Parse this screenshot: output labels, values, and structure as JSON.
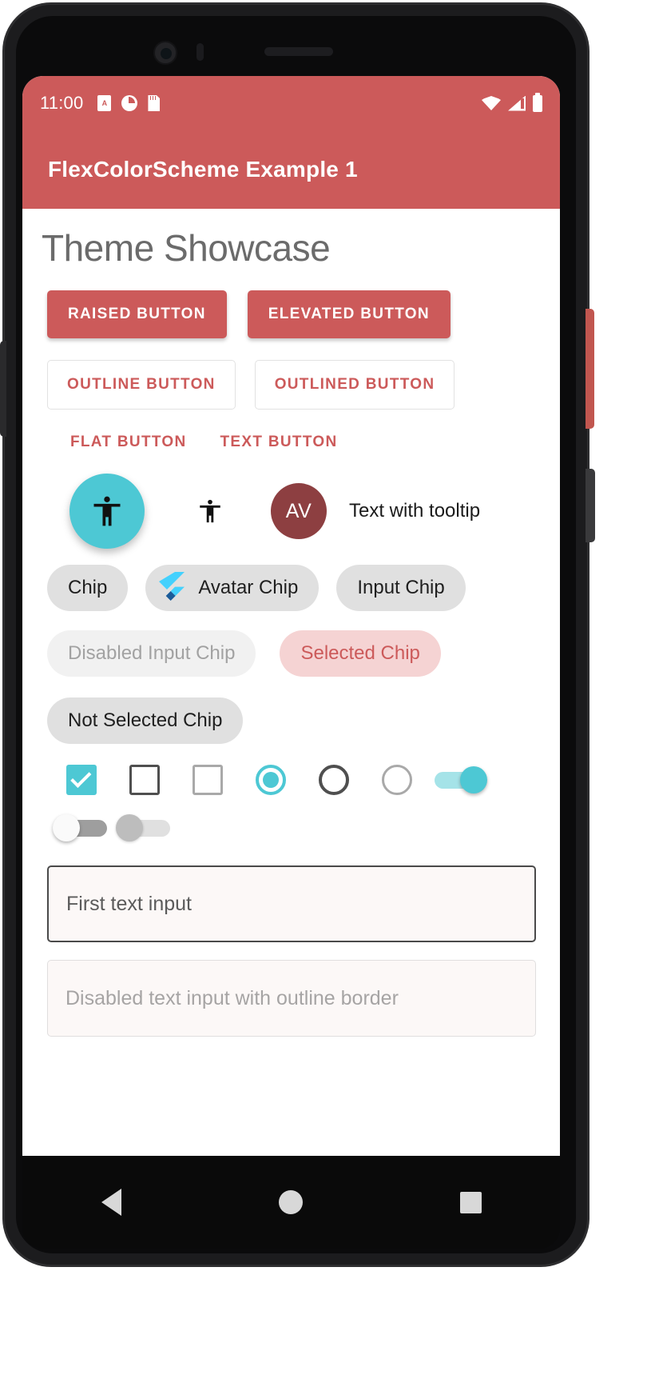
{
  "device": {
    "statusbar": {
      "time": "11:00",
      "left_icons": [
        "alarm-card-icon",
        "do-not-disturb-icon",
        "sdcard-icon"
      ],
      "right_icons": [
        "wifi-icon",
        "cellular-signal-icon",
        "battery-icon"
      ]
    },
    "navbar": {
      "back_label": "back-icon",
      "home_label": "home-icon",
      "recents_label": "recents-icon"
    }
  },
  "appbar": {
    "title": "FlexColorScheme Example 1"
  },
  "page": {
    "title": "Theme Showcase"
  },
  "buttons": {
    "raised": "RAISED BUTTON",
    "elevated": "ELEVATED BUTTON",
    "outline": "OUTLINE BUTTON",
    "outlined": "OUTLINED BUTTON",
    "flat": "FLAT BUTTON",
    "text": "TEXT BUTTON"
  },
  "icons_row": {
    "fab_icon": "accessibility-icon",
    "icon_button": "accessibility-icon",
    "avatar_initials": "AV",
    "tooltip_text": "Text with tooltip"
  },
  "chips": {
    "plain": "Chip",
    "avatar": "Avatar Chip",
    "input": "Input Chip",
    "disabled_input": "Disabled Input Chip",
    "selected": "Selected Chip",
    "not_selected": "Not Selected Chip"
  },
  "text_fields": {
    "first": "First text input",
    "disabled": "Disabled text input with outline border"
  },
  "colors": {
    "primary": "#CC5A5A",
    "secondary": "#4DC8D4",
    "avatar_bg": "#8D3F41",
    "selected_chip_bg": "#F5D3D3",
    "chip_bg": "#E0E0E0",
    "page_title": "#6B6B6B",
    "field_fill": "#FCF8F7"
  }
}
